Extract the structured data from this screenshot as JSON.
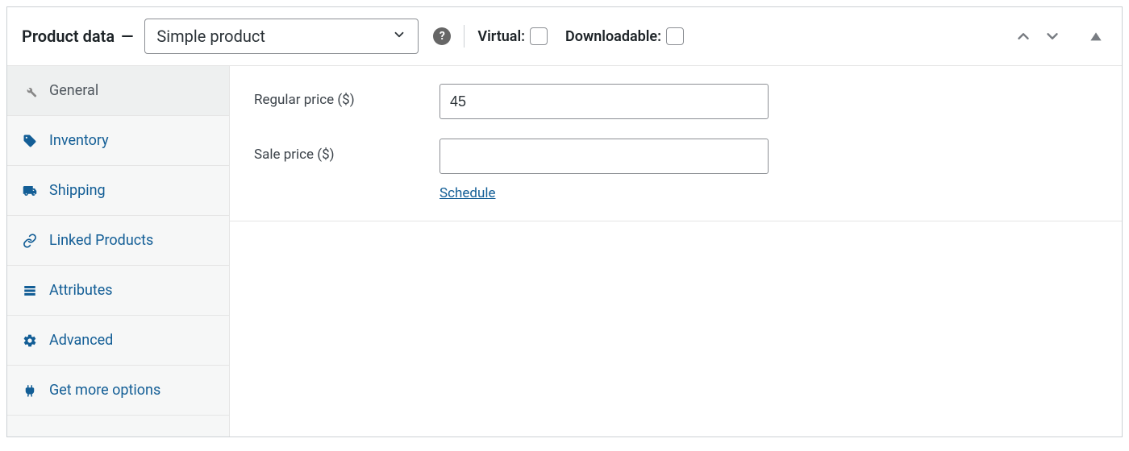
{
  "header": {
    "title": "Product data",
    "dash": "—",
    "product_type": "Simple product",
    "help_glyph": "?",
    "virtual_label": "Virtual:",
    "downloadable_label": "Downloadable:"
  },
  "tabs": [
    {
      "label": "General",
      "active": true
    },
    {
      "label": "Inventory",
      "active": false
    },
    {
      "label": "Shipping",
      "active": false
    },
    {
      "label": "Linked Products",
      "active": false
    },
    {
      "label": "Attributes",
      "active": false
    },
    {
      "label": "Advanced",
      "active": false
    },
    {
      "label": "Get more options",
      "active": false
    }
  ],
  "general": {
    "regular_price_label": "Regular price ($)",
    "regular_price_value": "45",
    "sale_price_label": "Sale price ($)",
    "sale_price_value": "",
    "schedule_link": "Schedule"
  },
  "colors": {
    "link": "#135e96",
    "border": "#ccd0d4",
    "muted": "#787c82"
  }
}
